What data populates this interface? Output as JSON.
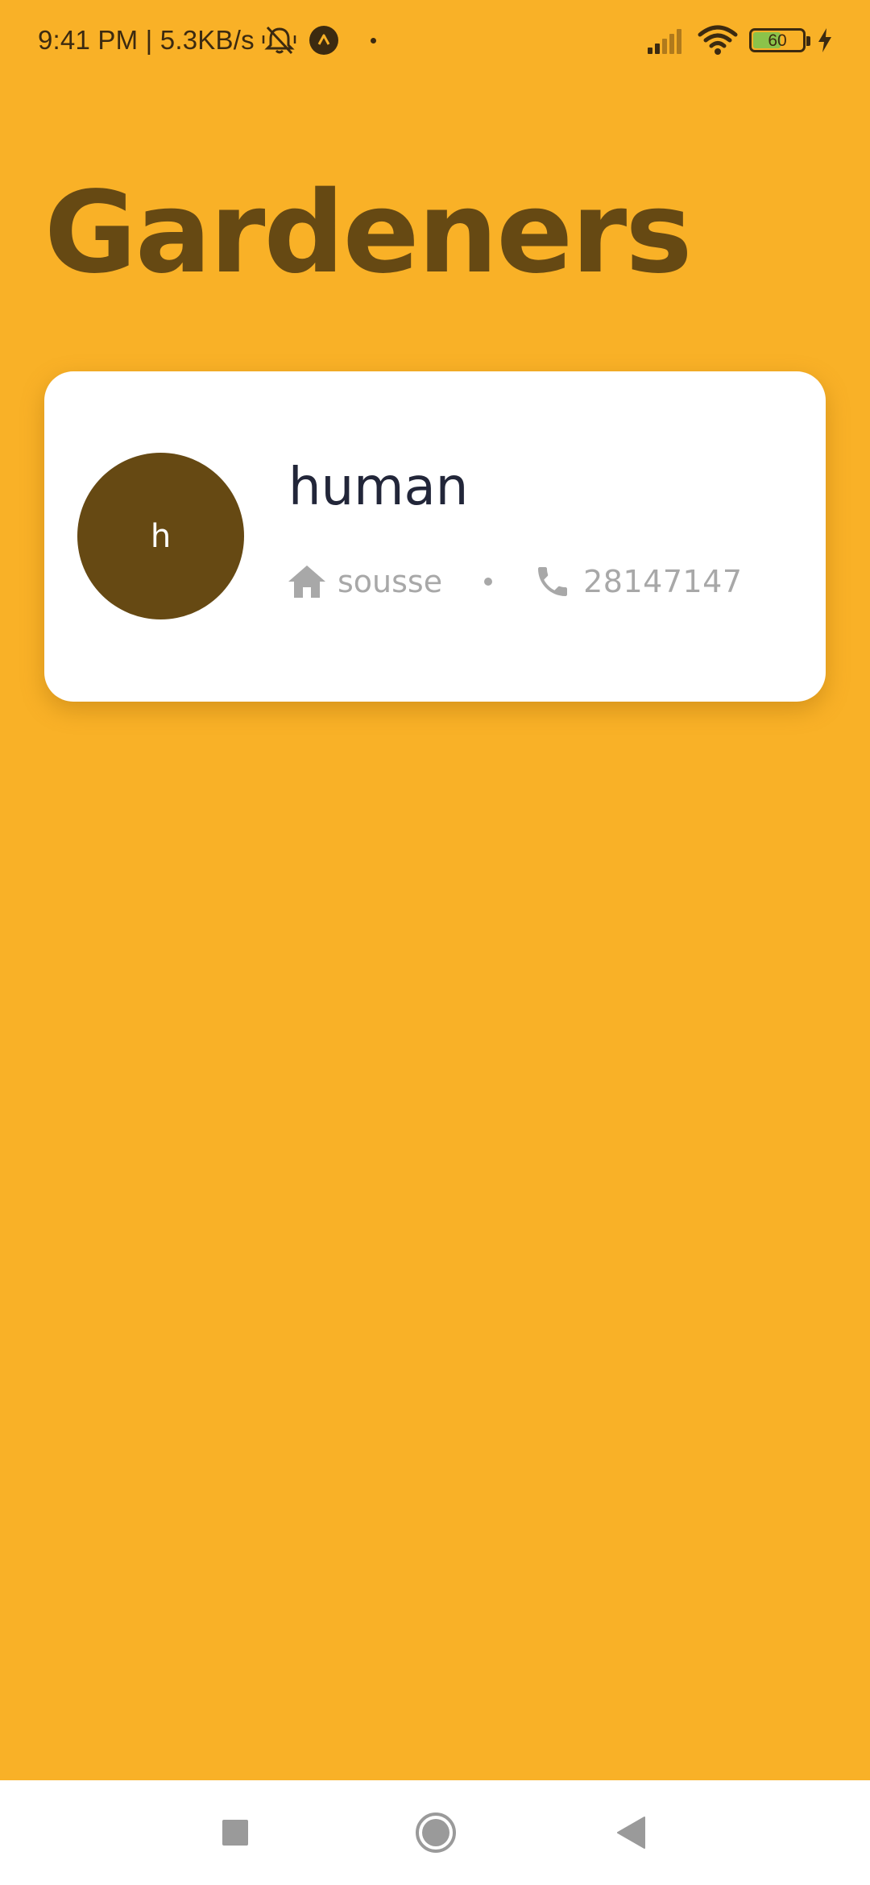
{
  "status_bar": {
    "time_speed": "9:41 PM | 5.3KB/s",
    "battery_level": "60",
    "battery_fraction": 0.6,
    "icons": [
      "bell-off-icon",
      "app-a-icon",
      "dot-icon",
      "signal-icon",
      "wifi-icon",
      "battery-icon",
      "charging-icon"
    ]
  },
  "page": {
    "title": "Gardeners",
    "background_color": "#F9B127",
    "title_color": "#664913"
  },
  "gardeners": [
    {
      "initial": "h",
      "name": "human",
      "city": "sousse",
      "phone": "28147147",
      "avatar_color": "#664913",
      "icons": [
        "home-icon",
        "phone-icon"
      ]
    }
  ],
  "nav_bar": {
    "buttons": [
      "recents-square-icon",
      "home-circle-icon",
      "back-triangle-icon"
    ]
  }
}
